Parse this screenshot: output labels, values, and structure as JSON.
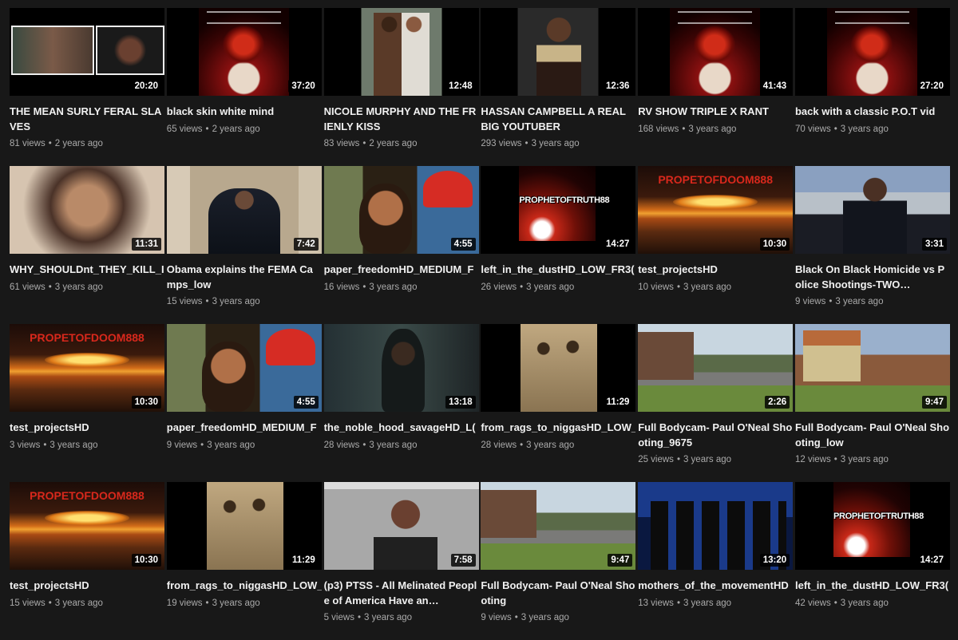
{
  "videos": [
    {
      "art": "a-mean",
      "duration": "20:20",
      "title": "THE MEAN SURLY FERAL SLAVES",
      "views": "81 views",
      "age": "2 years ago"
    },
    {
      "art": "a-pot",
      "duration": "37:20",
      "title": "black skin white mind",
      "views": "65 views",
      "age": "2 years ago"
    },
    {
      "art": "a-couple",
      "duration": "12:48",
      "title": "NICOLE MURPHY AND THE FRIENLY KISS",
      "views": "83 views",
      "age": "2 years ago"
    },
    {
      "art": "a-man",
      "duration": "12:36",
      "title": "HASSAN CAMPBELL A REAL BIG YOUTUBER",
      "views": "293 views",
      "age": "3 years ago"
    },
    {
      "art": "a-pot",
      "duration": "41:43",
      "title": "RV SHOW TRIPLE X RANT",
      "views": "168 views",
      "age": "3 years ago"
    },
    {
      "art": "a-pot",
      "duration": "27:20",
      "title": "back with a classic P.O.T vid",
      "views": "70 views",
      "age": "3 years ago"
    },
    {
      "art": "a-face",
      "duration": "11:31",
      "title": "WHY_SHOULDnt_THEY_KILL_I",
      "views": "61 views",
      "age": "3 years ago",
      "one": true
    },
    {
      "art": "a-speech",
      "duration": "7:42",
      "title": "Obama explains the FEMA Camps_low",
      "views": "15 views",
      "age": "3 years ago"
    },
    {
      "art": "a-selfie",
      "duration": "4:55",
      "title": "paper_freedomHD_MEDIUM_F",
      "views": "16 views",
      "age": "3 years ago",
      "one": true
    },
    {
      "art": "a-potword",
      "duration": "14:27",
      "title": "left_in_the_dustHD_LOW_FR3(",
      "views": "26 views",
      "age": "3 years ago",
      "one": true,
      "word": "PROPHETOFTRUTH88"
    },
    {
      "art": "a-doom",
      "duration": "10:30",
      "title": "test_projectsHD",
      "views": "10 views",
      "age": "3 years ago",
      "word": "PROPETOFDOOM888"
    },
    {
      "art": "a-news",
      "duration": "3:31",
      "title": "Black On Black Homicide vs Police Shootings-TWO…",
      "views": "9 views",
      "age": "3 years ago"
    },
    {
      "art": "a-doom",
      "duration": "10:30",
      "title": "test_projectsHD",
      "views": "3 views",
      "age": "3 years ago",
      "word": "PROPETOFDOOM888"
    },
    {
      "art": "a-selfie",
      "duration": "4:55",
      "title": "paper_freedomHD_MEDIUM_F",
      "views": "9 views",
      "age": "3 years ago",
      "one": true
    },
    {
      "art": "a-hood",
      "duration": "13:18",
      "title": "the_noble_hood_savageHD_L(",
      "views": "28 views",
      "age": "3 years ago",
      "one": true
    },
    {
      "art": "a-sepia",
      "duration": "11:29",
      "title": "from_rags_to_niggasHD_LOW_",
      "views": "28 views",
      "age": "3 years ago",
      "one": true
    },
    {
      "art": "a-street",
      "duration": "2:26",
      "title": "Full Bodycam- Paul O'Neal Shooting_9675",
      "views": "25 views",
      "age": "3 years ago"
    },
    {
      "art": "a-house",
      "duration": "9:47",
      "title": "Full Bodycam- Paul O'Neal Shooting_low",
      "views": "12 views",
      "age": "3 years ago"
    },
    {
      "art": "a-doom",
      "duration": "10:30",
      "title": "test_projectsHD",
      "views": "15 views",
      "age": "3 years ago",
      "word": "PROPETOFDOOM888"
    },
    {
      "art": "a-sepia",
      "duration": "11:29",
      "title": "from_rags_to_niggasHD_LOW_",
      "views": "19 views",
      "age": "3 years ago",
      "one": true
    },
    {
      "art": "a-zoom",
      "duration": "7:58",
      "title": "(p3) PTSS - All Melinated People of America Have an…",
      "views": "5 views",
      "age": "3 years ago"
    },
    {
      "art": "a-street",
      "duration": "9:47",
      "title": "Full Bodycam- Paul O'Neal Shooting",
      "views": "9 views",
      "age": "3 years ago"
    },
    {
      "art": "a-dnc",
      "duration": "13:20",
      "title": "mothers_of_the_movementHD",
      "views": "13 views",
      "age": "3 years ago",
      "one": true
    },
    {
      "art": "a-potword",
      "duration": "14:27",
      "title": "left_in_the_dustHD_LOW_FR3(",
      "views": "42 views",
      "age": "3 years ago",
      "one": true,
      "word": "PROPHETOFTRUTH88"
    }
  ]
}
